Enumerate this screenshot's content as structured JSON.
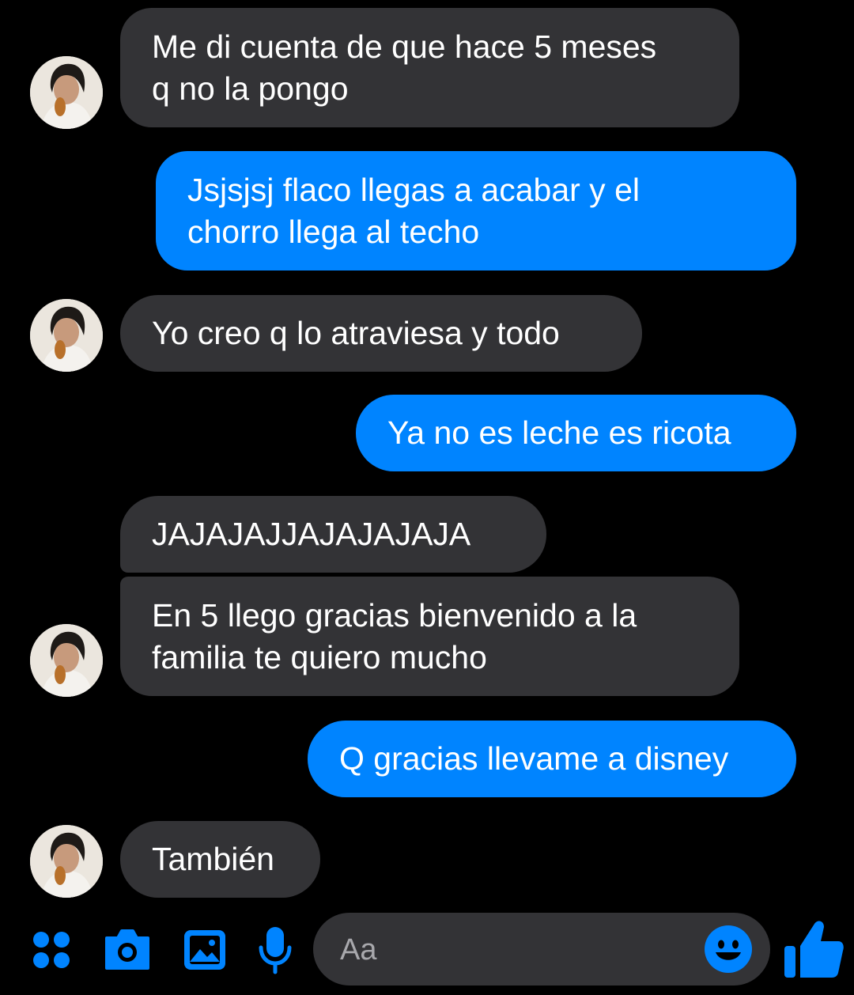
{
  "messages": [
    {
      "from": "them",
      "text": "Me di cuenta de que hace 5 meses\nq no la pongo"
    },
    {
      "from": "me",
      "text": "Jsjsjsj flaco llegas a acabar y el\nchorro llega al techo"
    },
    {
      "from": "them",
      "text": "Yo creo q lo atraviesa y todo"
    },
    {
      "from": "me",
      "text": "Ya no es leche es ricota"
    },
    {
      "from": "them",
      "text": "JAJAJAJJAJAJAJAJA"
    },
    {
      "from": "them",
      "text": "En 5 llego gracias bienvenido a la\nfamilia te quiero mucho"
    },
    {
      "from": "me",
      "text": "Q gracias llevame a disney"
    },
    {
      "from": "them",
      "text": "También"
    }
  ],
  "composer": {
    "placeholder": "Aa",
    "icons": [
      "apps-icon",
      "camera-icon",
      "gallery-icon",
      "microphone-icon",
      "emoji-icon",
      "thumbs-up-icon"
    ]
  },
  "colors": {
    "background": "#000000",
    "incoming_bubble": "#333336",
    "outgoing_bubble": "#0084ff",
    "accent": "#0084ff"
  }
}
